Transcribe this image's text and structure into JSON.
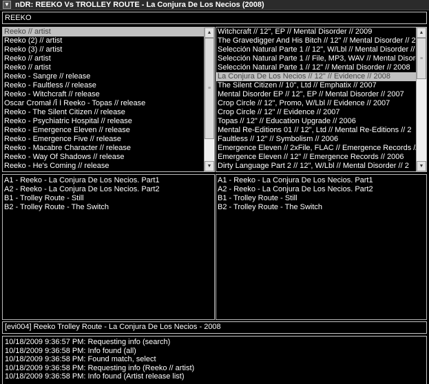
{
  "window": {
    "icon": "app-menu-icon",
    "title": "nDR: REEKO Vs TROLLEY ROUTE - La Conjura De Los Necios (2008)"
  },
  "search": {
    "value": "REEKO"
  },
  "artist_list": {
    "selected_index": 0,
    "items": [
      "Reeko // artist",
      "Reeko (2) // artist",
      "Reeko (3) // artist",
      "Reeko // artist",
      "Reeko // artist",
      "Reeko - Sangre // release",
      "Reeko - Faultless // release",
      "Reeko - Witchcraft // release",
      "Oscar Cromał /Ī İ Reeko - Topas // release",
      "Reeko - The Silent Citizen // release",
      "Reeko - Psychiatric Hospital // release",
      "Reeko - Emergence Eleven // release",
      "Reeko - Emergence Five // release",
      "Reeko - Macabre Character // release",
      "Reeko - Way Of Shadows // release",
      "Reeko - He's Coming // release"
    ]
  },
  "release_list": {
    "selected_index": 5,
    "items": [
      "Witchcraft // 12\", EP // Mental Disorder // 2009",
      "The Gravedigger And His Bitch // 12\" // Mental Disorder // 2",
      "Selección Natural Parte 1 // 12\", W/Lbl // Mental Disorder // 2",
      "Selección Natural Parte 1 // File, MP3, WAV // Mental Disorder",
      "Selección Natural Parte 1 // 12\" // Mental Disorder // 2008",
      "La Conjura De Los Necios // 12\" // Evidence // 2008",
      "The Silent Citizen // 10\", Ltd // Emphatix // 2007",
      "Mental Disorder EP // 12\", EP // Mental Disorder // 2007",
      "Crop Circle // 12\", Promo, W/Lbl // Evidence // 2007",
      "Crop Circle // 12\" // Evidence // 2007",
      "Topas // 12\" // Education Upgrade // 2006",
      "Mental Re-Editions 01 // 12\", Ltd // Mental Re-Editions // 2",
      "Faultless // 12\" // Symbolism // 2006",
      "Emergence Eleven // 2xFile, FLAC // Emergence Records // 2",
      "Emergence Eleven // 12\" // Emergence Records // 2006",
      "Dirty Language Part 2 // 12\", W/Lbl // Mental Disorder // 2"
    ]
  },
  "tracklist_left": {
    "items": [
      "A1 - Reeko - La Conjura De Los Necios. Part1",
      "A2 - Reeko - La Conjura De Los Necios. Part2",
      "B1 - Trolley Route - Still",
      "B2 - Trolley Route - The Switch"
    ]
  },
  "tracklist_right": {
    "items": [
      "A1 - Reeko - La Conjura De Los Necios. Part1",
      "A2 - Reeko - La Conjura De Los Necios. Part2",
      "B1 - Trolley Route - Still",
      "B2 - Trolley Route - The Switch"
    ]
  },
  "result_line": {
    "value": "[evi004] Reeko Trolley Route - La Conjura De Los Necios - 2008"
  },
  "log": {
    "items": [
      "10/18/2009 9:36:57 PM: Requesting info (search)",
      "10/18/2009 9:36:58 PM: Info found (all)",
      "10/18/2009 9:36:58 PM: Found match, select",
      "10/18/2009 9:36:58 PM: Requesting info (Reeko // artist)",
      "10/18/2009 9:36:58 PM: Info found (Artist release list)"
    ]
  }
}
